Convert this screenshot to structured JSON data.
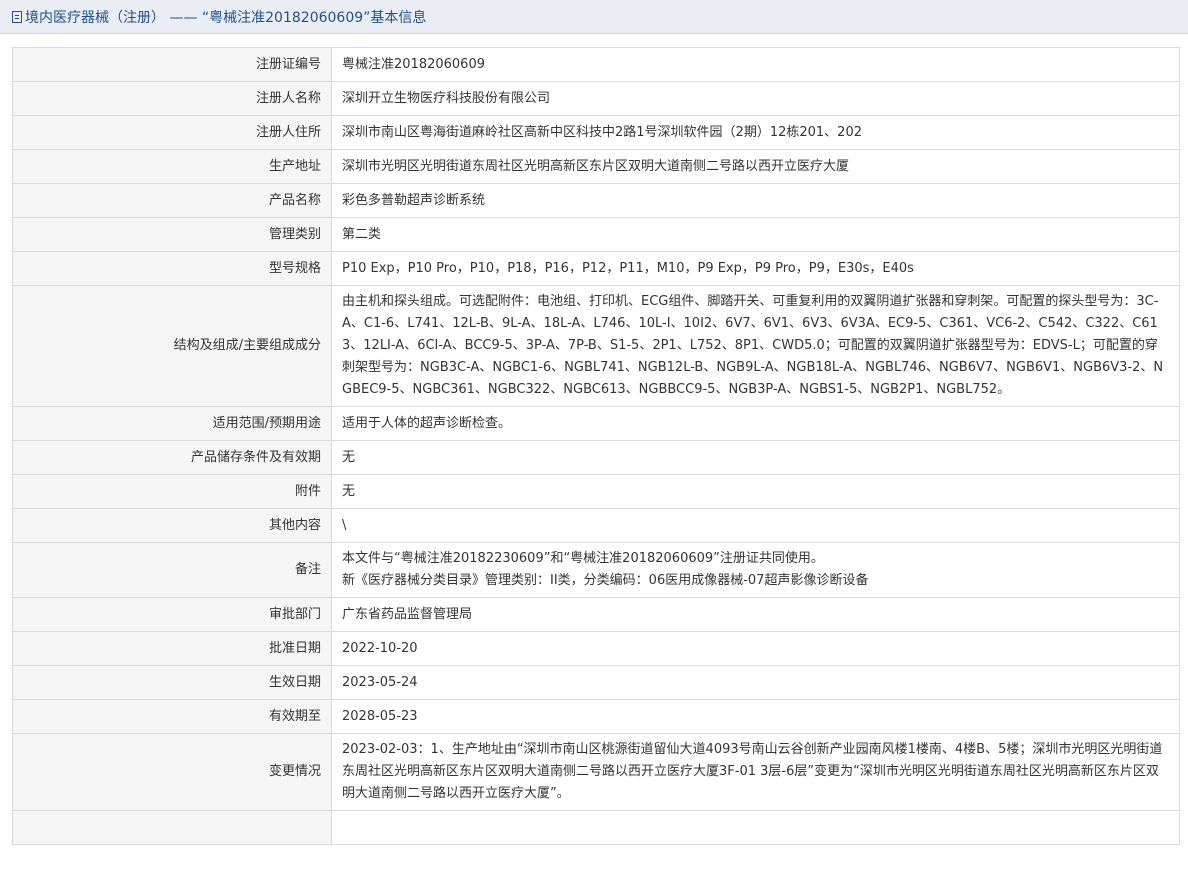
{
  "header": {
    "icon": "document-icon",
    "title": "境内医疗器械（注册） —— “粤械注准20182060609”基本信息"
  },
  "rows": [
    {
      "label": "注册证编号",
      "value": "粤械注准20182060609"
    },
    {
      "label": "注册人名称",
      "value": "深圳开立生物医疗科技股份有限公司"
    },
    {
      "label": "注册人住所",
      "value": "深圳市南山区粤海街道麻岭社区高新中区科技中2路1号深圳软件园（2期）12栋201、202"
    },
    {
      "label": "生产地址",
      "value": "深圳市光明区光明街道东周社区光明高新区东片区双明大道南侧二号路以西开立医疗大厦"
    },
    {
      "label": "产品名称",
      "value": "彩色多普勒超声诊断系统"
    },
    {
      "label": "管理类别",
      "value": "第二类"
    },
    {
      "label": "型号规格",
      "value": "P10 Exp，P10 Pro，P10，P18，P16，P12，P11，M10，P9 Exp，P9 Pro，P9，E30s，E40s"
    },
    {
      "label": "结构及组成/主要组成成分",
      "value": "由主机和探头组成。可选配附件：电池组、打印机、ECG组件、脚踏开关、可重复利用的双翼阴道扩张器和穿刺架。可配置的探头型号为：3C-A、C1-6、L741、12L-B、9L-A、18L-A、L746、10L-I、10I2、6V7、6V1、6V3、6V3A、EC9-5、C361、VC6-2、C542、C322、C613、12LI-A、6CI-A、BCC9-5、3P-A、7P-B、S1-5、2P1、L752、8P1、CWD5.0；可配置的双翼阴道扩张器型号为：EDVS-L；可配置的穿刺架型号为：NGB3C-A、NGBC1-6、NGBL741、NGB12L-B、NGB9L-A、NGB18L-A、NGBL746、NGB6V7、NGB6V1、NGB6V3-2、NGBEC9-5、NGBC361、NGBC322、NGBC613、NGBBCC9-5、NGB3P-A、NGBS1-5、NGB2P1、NGBL752。"
    },
    {
      "label": "适用范围/预期用途",
      "value": "适用于人体的超声诊断检查。"
    },
    {
      "label": "产品储存条件及有效期",
      "value": "无"
    },
    {
      "label": "附件",
      "value": "无"
    },
    {
      "label": "其他内容",
      "value": "\\"
    },
    {
      "label": "备注",
      "value": "本文件与“粤械注准20182230609”和“粤械注准20182060609”注册证共同使用。\n新《医疗器械分类目录》管理类别：II类，分类编码：06医用成像器械-07超声影像诊断设备"
    },
    {
      "label": "审批部门",
      "value": "广东省药品监督管理局"
    },
    {
      "label": "批准日期",
      "value": "2022-10-20"
    },
    {
      "label": "生效日期",
      "value": "2023-05-24"
    },
    {
      "label": "有效期至",
      "value": "2028-05-23"
    },
    {
      "label": "变更情况",
      "value": "2023-02-03：1、生产地址由“深圳市南山区桃源街道留仙大道4093号南山云谷创新产业园南风楼1楼南、4楼B、5楼；深圳市光明区光明街道东周社区光明高新区东片区双明大道南侧二号路以西开立医疗大厦3F-01 3层-6层”变更为“深圳市光明区光明街道东周社区光明高新区东片区双明大道南侧二号路以西开立医疗大厦”。"
    },
    {
      "label": "",
      "value": ""
    }
  ]
}
